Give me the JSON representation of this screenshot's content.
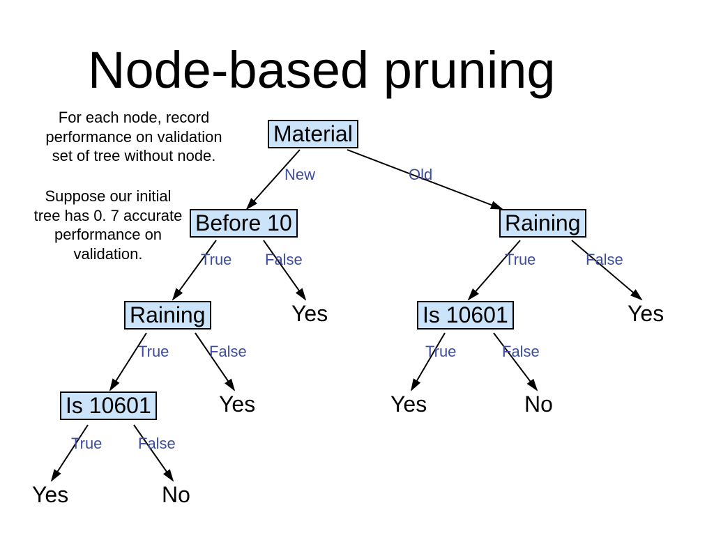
{
  "title": "Node-based pruning",
  "annotations": {
    "top_left": "For each node, record\nperformance on validation\nset of tree without node.",
    "left_mid": "Suppose our initial\ntree has 0. 7 accurate\nperformance on\nvalidation."
  },
  "nodes": {
    "material": "Material",
    "before10": "Before 10",
    "raining_right": "Raining",
    "raining_left": "Raining",
    "is10601_right": "Is 10601",
    "is10601_left": "Is 10601"
  },
  "leaves": {
    "before10_false": "Yes",
    "raining_right_false": "Yes",
    "is10601_right_true": "Yes",
    "is10601_right_false": "No",
    "raining_left_false": "Yes",
    "is10601_left_true": "Yes",
    "is10601_left_false": "No"
  },
  "edge_labels": {
    "material_new": "New",
    "material_old": "Old",
    "true": "True",
    "false": "False"
  },
  "colors": {
    "node_fill": "#cbe4f9",
    "edge_text": "#3d4ca3"
  }
}
